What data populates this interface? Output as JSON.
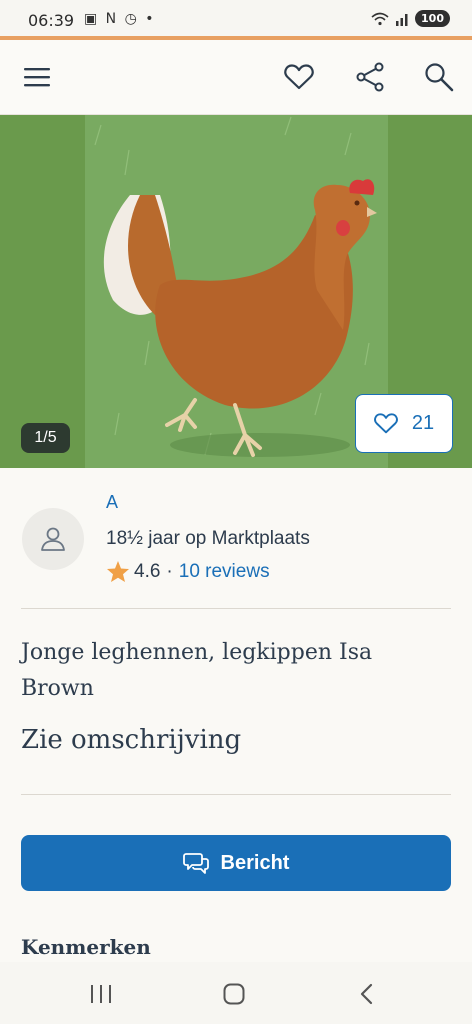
{
  "status_bar": {
    "time": "06:39",
    "notification_icons": "▣ N ◷ •",
    "battery": "100"
  },
  "header": {
    "menu_icon": "menu-icon",
    "favorite_icon": "heart-icon",
    "share_icon": "share-icon",
    "search_icon": "search-icon"
  },
  "gallery": {
    "counter": "1/5",
    "favorites_count": "21"
  },
  "seller": {
    "name": "A",
    "member_since": "18½ jaar op Marktplaats",
    "rating": "4.6",
    "separator": "·",
    "reviews": "10 reviews"
  },
  "listing": {
    "title": "Jonge leghennen, legkippen Isa Brown",
    "price_text": "Zie omschrijving"
  },
  "actions": {
    "message_label": "Bericht"
  },
  "sections": {
    "features_title": "Kenmerken"
  },
  "colors": {
    "brand_blue": "#1a6fb7",
    "accent_orange": "#e8a062",
    "star": "#f0a046",
    "text_dark": "#2d3c4d"
  }
}
